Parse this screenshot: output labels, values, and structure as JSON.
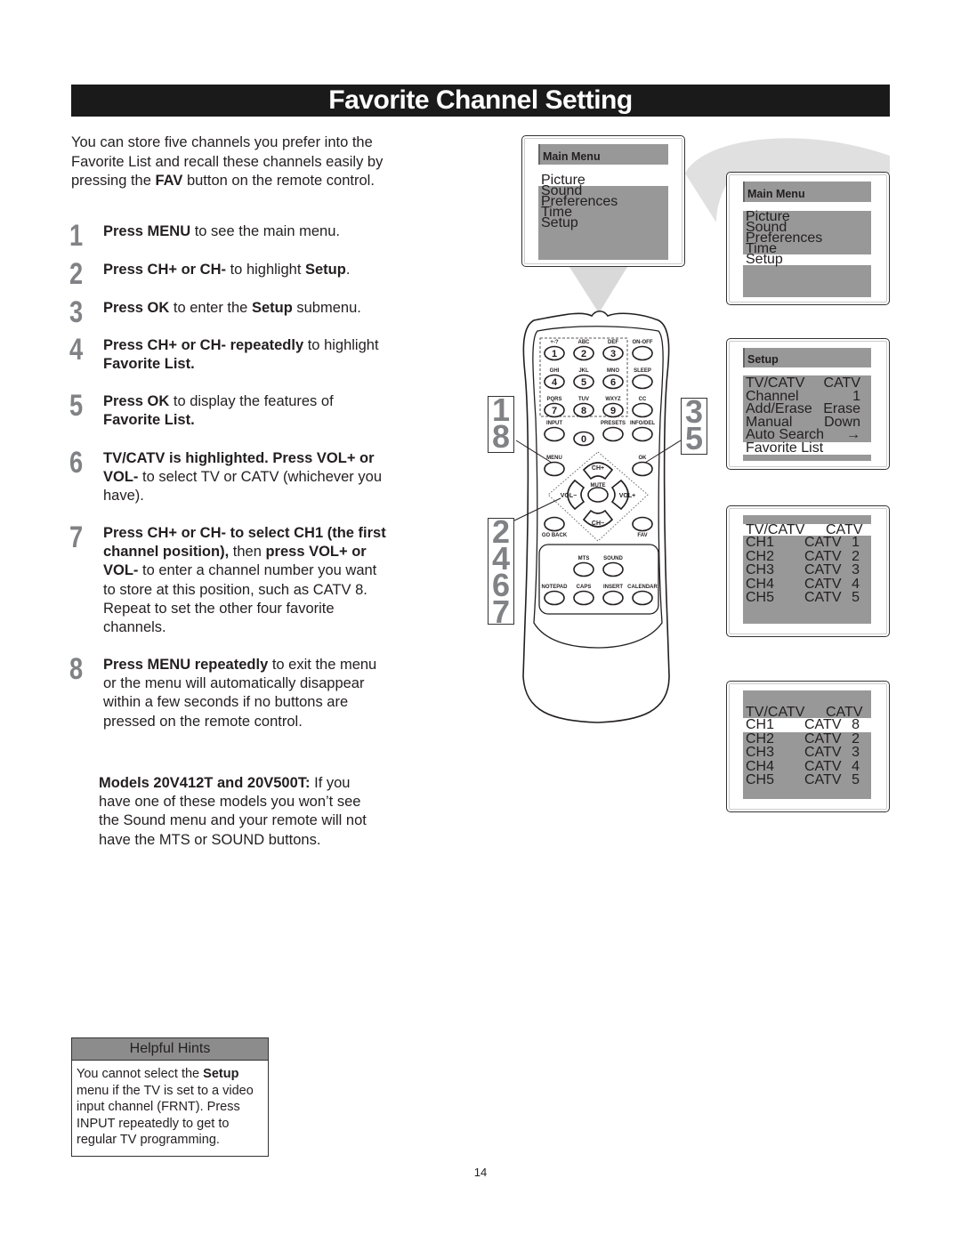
{
  "title": "Favorite Channel Setting",
  "intro": {
    "before": "You can store five channels you prefer into the Favorite List and recall these channels easily by pressing the ",
    "bold": "FAV",
    "after": " button on the remote control."
  },
  "steps": [
    {
      "num": "1",
      "parts": [
        {
          "b": "Press MENU"
        },
        {
          "t": " to see the main menu."
        }
      ]
    },
    {
      "num": "2",
      "parts": [
        {
          "b": "Press CH+ or CH-"
        },
        {
          "t": " to highlight "
        },
        {
          "b": "Setup"
        },
        {
          "t": "."
        }
      ]
    },
    {
      "num": "3",
      "parts": [
        {
          "b": "Press OK"
        },
        {
          "t": " to enter the "
        },
        {
          "b": "Setup"
        },
        {
          "t": " submenu."
        }
      ]
    },
    {
      "num": "4",
      "parts": [
        {
          "b": "Press CH+ or CH- repeatedly"
        },
        {
          "t": " to highlight "
        },
        {
          "b": "Favorite List."
        }
      ]
    },
    {
      "num": "5",
      "parts": [
        {
          "b": "Press OK"
        },
        {
          "t": " to display the features of "
        },
        {
          "b": "Favorite List."
        }
      ]
    },
    {
      "num": "6",
      "parts": [
        {
          "b": "TV/CATV is highlighted. Press VOL+ or VOL-"
        },
        {
          "t": " to select TV or CATV (whichever you have)."
        }
      ]
    },
    {
      "num": "7",
      "parts": [
        {
          "b": "Press CH+ or CH- to select CH1 (the first channel position),"
        },
        {
          "t": " then "
        },
        {
          "b": "press VOL+ or VOL-"
        },
        {
          "t": " to enter a channel number you want to store at this position, such as CATV 8. Repeat to set the other four favorite channels."
        }
      ]
    },
    {
      "num": "8",
      "parts": [
        {
          "b": "Press MENU repeatedly"
        },
        {
          "t": " to exit the menu or the menu will automatically disappear within a few seconds if no buttons are pressed on the remote control."
        }
      ]
    }
  ],
  "models_note": {
    "bold": "Models 20V412T and 20V500T:",
    "text": " If you have one of these models you won’t see the Sound menu and your remote will not have the MTS or SOUND buttons."
  },
  "hints": {
    "header": "Helpful Hints",
    "before": "You cannot select the ",
    "bold": "Setup",
    "after": " menu if the TV is set to a video input channel (FRNT). Press INPUT repeatedly to get to regular TV programming."
  },
  "page_number": "14",
  "screens": {
    "main_menu_1": {
      "header": "Main Menu",
      "items": [
        "Picture",
        "Sound",
        "Preferences",
        "Time",
        "Setup"
      ],
      "highlighted": "Picture"
    },
    "main_menu_2": {
      "header": "Main Menu",
      "items": [
        "Picture",
        "Sound",
        "Preferences",
        "Time",
        "Setup"
      ],
      "highlighted": "Setup"
    },
    "setup": {
      "header": "Setup",
      "rows": [
        {
          "label": "TV/CATV",
          "value": "CATV"
        },
        {
          "label": "Channel",
          "value": "1"
        },
        {
          "label": "Add/Erase",
          "value": "Erase"
        },
        {
          "label": "Manual",
          "value": "Down"
        },
        {
          "label": "Auto Search",
          "value": "→"
        }
      ],
      "highlighted": "Favorite List"
    },
    "fav_1": {
      "header_label": "TV/CATV",
      "header_value": "CATV",
      "header_highlighted": true,
      "rows": [
        [
          "CH1",
          "CATV",
          "1"
        ],
        [
          "CH2",
          "CATV",
          "2"
        ],
        [
          "CH3",
          "CATV",
          "3"
        ],
        [
          "CH4",
          "CATV",
          "4"
        ],
        [
          "CH5",
          "CATV",
          "5"
        ]
      ]
    },
    "fav_2": {
      "header_label": "TV/CATV",
      "header_value": "CATV",
      "highlighted_row": 0,
      "rows": [
        [
          "CH1",
          "CATV",
          "8"
        ],
        [
          "CH2",
          "CATV",
          "2"
        ],
        [
          "CH3",
          "CATV",
          "3"
        ],
        [
          "CH4",
          "CATV",
          "4"
        ],
        [
          "CH5",
          "CATV",
          "5"
        ]
      ]
    }
  },
  "remote": {
    "keypad": [
      {
        "sub": "+-?",
        "key": "1"
      },
      {
        "sub": "ABC",
        "key": "2"
      },
      {
        "sub": "DEF",
        "key": "3"
      },
      {
        "sub": "ON-OFF",
        "key": ""
      },
      {
        "sub": "GHI",
        "key": "4"
      },
      {
        "sub": "JKL",
        "key": "5"
      },
      {
        "sub": "MNO",
        "key": "6"
      },
      {
        "sub": "SLEEP",
        "key": ""
      },
      {
        "sub": "PQRS",
        "key": "7"
      },
      {
        "sub": "TUV",
        "key": "8"
      },
      {
        "sub": "WXYZ",
        "key": "9"
      },
      {
        "sub": "CC",
        "key": ""
      }
    ],
    "row4": [
      {
        "sub": "INPUT",
        "key": ""
      },
      {
        "sub": "",
        "key": "0"
      },
      {
        "sub": "PRESETS",
        "key": ""
      },
      {
        "sub": "INFO/DEL",
        "key": ""
      }
    ],
    "menu": "MENU",
    "ok": "OK",
    "ch_up": "CH+",
    "ch_down": "CH−",
    "vol_down": "VOL−",
    "vol_up": "VOL+",
    "mute": "MUTE",
    "go_back": "GO BACK",
    "fav": "FAV",
    "lower": [
      {
        "label": "MTS"
      },
      {
        "label": "SOUND"
      },
      {
        "label": "NOTEPAD"
      },
      {
        "label": "CAPS"
      },
      {
        "label": "INSERT"
      },
      {
        "label": "CALENDAR"
      }
    ],
    "callouts": {
      "left_top": [
        "1",
        "8"
      ],
      "right": [
        "3",
        "5"
      ],
      "left_bottom": [
        "2",
        "4",
        "6",
        "7"
      ]
    }
  }
}
